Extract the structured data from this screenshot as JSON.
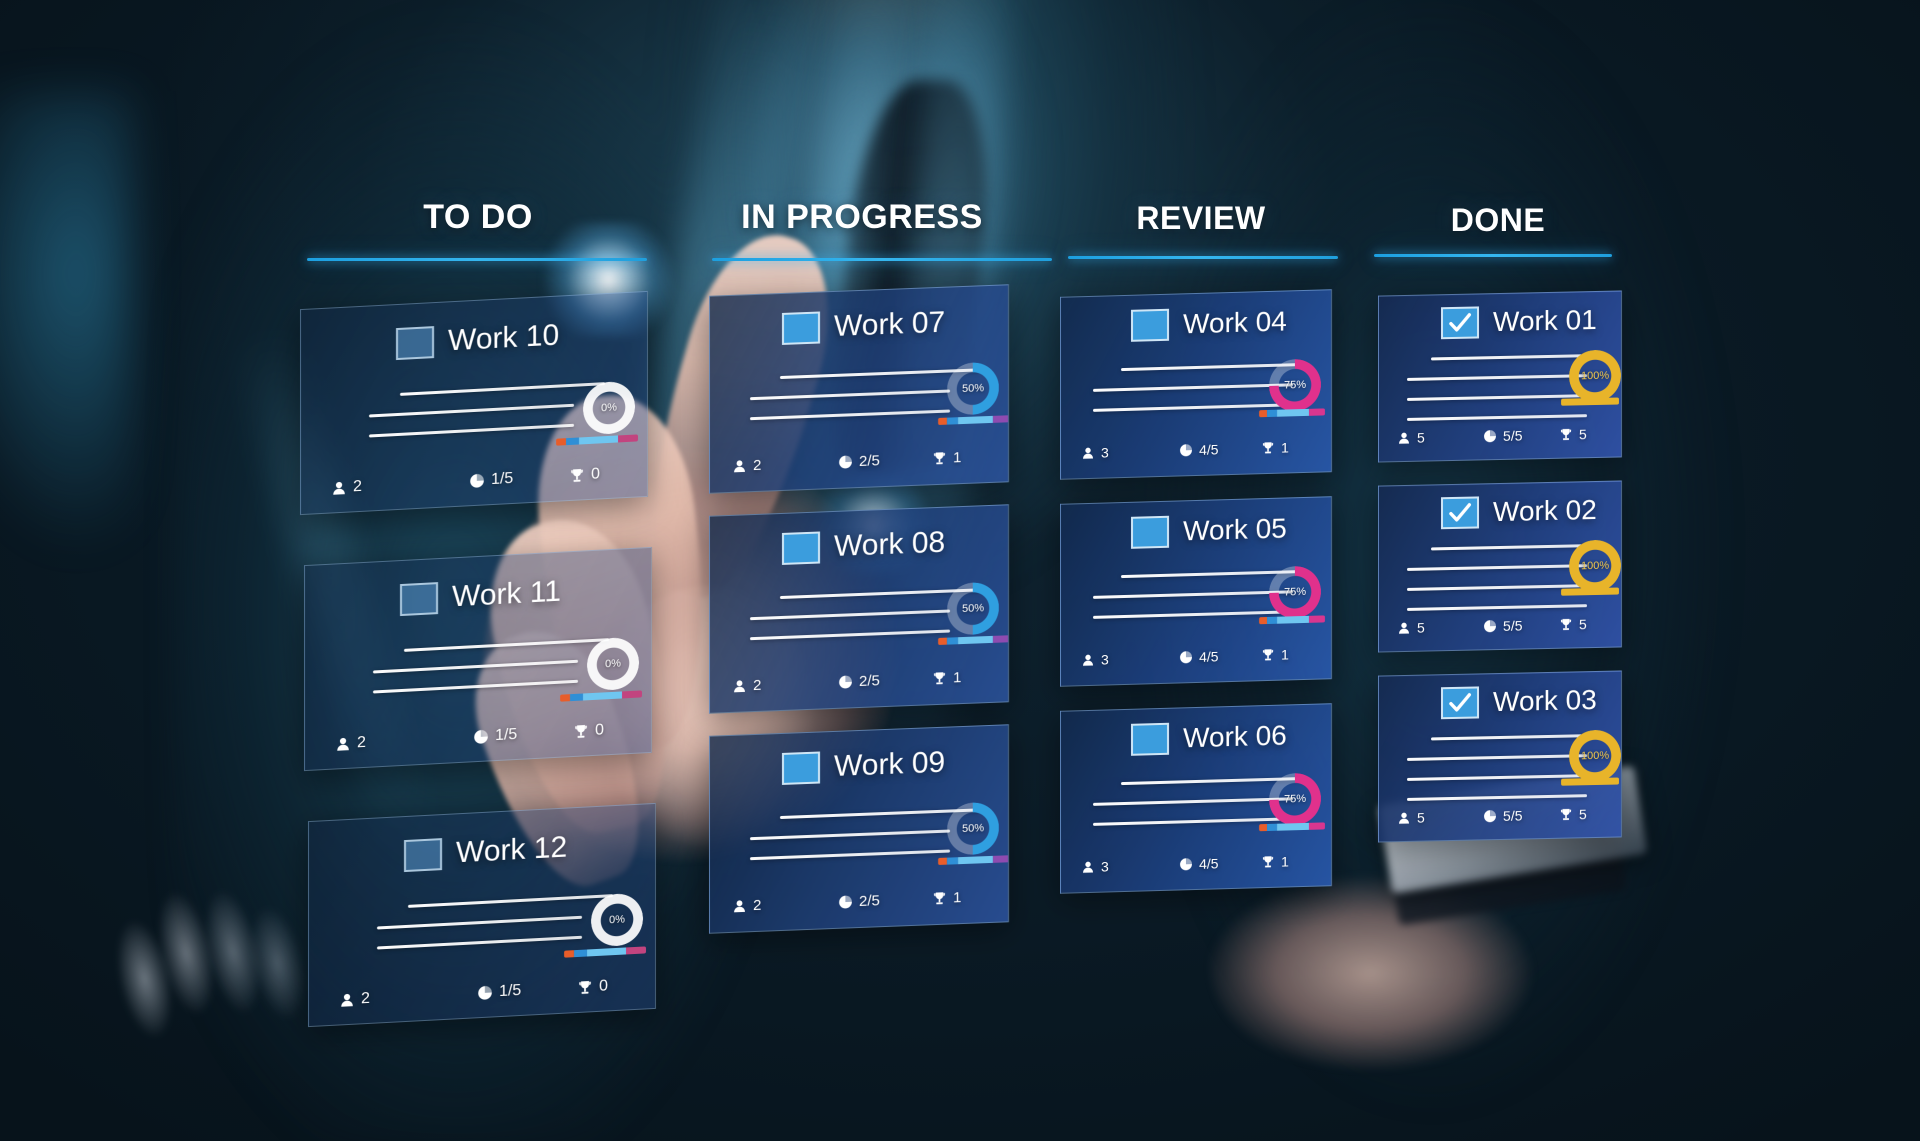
{
  "board": {
    "columns": [
      {
        "id": "todo",
        "title": "TO DO",
        "accent": "#2ba4e3",
        "cards": [
          {
            "title": "Work 10",
            "checked": false,
            "progress_label": "0%",
            "progress_value": 0,
            "ring_color": "#ffffff",
            "lines": 3,
            "members_icon": "person-icon",
            "members": "2",
            "tasks_icon": "pie-clock-icon",
            "tasks": "1/5",
            "awards_icon": "trophy-icon",
            "awards": "0",
            "segments": [
              "#e85d2a",
              "#2f8fd6",
              "#6fc6f0",
              "#c2447f"
            ]
          },
          {
            "title": "Work 11",
            "checked": false,
            "progress_label": "0%",
            "progress_value": 0,
            "ring_color": "#ffffff",
            "lines": 3,
            "members_icon": "person-icon",
            "members": "2",
            "tasks_icon": "pie-clock-icon",
            "tasks": "1/5",
            "awards_icon": "trophy-icon",
            "awards": "0",
            "segments": [
              "#e85d2a",
              "#2f8fd6",
              "#6fc6f0",
              "#c2447f"
            ]
          },
          {
            "title": "Work 12",
            "checked": false,
            "progress_label": "0%",
            "progress_value": 0,
            "ring_color": "#ffffff",
            "lines": 3,
            "members_icon": "person-icon",
            "members": "2",
            "tasks_icon": "pie-clock-icon",
            "tasks": "1/5",
            "awards_icon": "trophy-icon",
            "awards": "0",
            "segments": [
              "#e85d2a",
              "#2f8fd6",
              "#6fc6f0",
              "#c2447f"
            ]
          }
        ]
      },
      {
        "id": "inprogress",
        "title": "IN PROGRESS",
        "accent": "#2ba4e3",
        "cards": [
          {
            "title": "Work 07",
            "checked": false,
            "progress_label": "50%",
            "progress_value": 50,
            "ring_color": "#2f9fe0",
            "lines": 3,
            "members_icon": "person-icon",
            "members": "2",
            "tasks_icon": "pie-clock-icon",
            "tasks": "2/5",
            "awards_icon": "trophy-icon",
            "awards": "1",
            "segments": [
              "#e85d2a",
              "#2f8fd6",
              "#6fc6f0",
              "#8e4bb0"
            ]
          },
          {
            "title": "Work 08",
            "checked": false,
            "progress_label": "50%",
            "progress_value": 50,
            "ring_color": "#2f9fe0",
            "lines": 3,
            "members_icon": "person-icon",
            "members": "2",
            "tasks_icon": "pie-clock-icon",
            "tasks": "2/5",
            "awards_icon": "trophy-icon",
            "awards": "1",
            "segments": [
              "#e85d2a",
              "#2f8fd6",
              "#6fc6f0",
              "#8e4bb0"
            ]
          },
          {
            "title": "Work 09",
            "checked": false,
            "progress_label": "50%",
            "progress_value": 50,
            "ring_color": "#2f9fe0",
            "lines": 3,
            "members_icon": "person-icon",
            "members": "2",
            "tasks_icon": "pie-clock-icon",
            "tasks": "2/5",
            "awards_icon": "trophy-icon",
            "awards": "1",
            "segments": [
              "#e85d2a",
              "#2f8fd6",
              "#6fc6f0",
              "#8e4bb0"
            ]
          }
        ]
      },
      {
        "id": "review",
        "title": "REVIEW",
        "accent": "#2ba4e3",
        "cards": [
          {
            "title": "Work 04",
            "checked": false,
            "progress_label": "75%",
            "progress_value": 75,
            "ring_color": "#e0318c",
            "lines": 3,
            "members_icon": "person-icon",
            "members": "3",
            "tasks_icon": "pie-clock-icon",
            "tasks": "4/5",
            "awards_icon": "trophy-icon",
            "awards": "1",
            "segments": [
              "#e85d2a",
              "#2f8fd6",
              "#6fc6f0",
              "#d8368f"
            ]
          },
          {
            "title": "Work 05",
            "checked": false,
            "progress_label": "75%",
            "progress_value": 75,
            "ring_color": "#e0318c",
            "lines": 3,
            "members_icon": "person-icon",
            "members": "3",
            "tasks_icon": "pie-clock-icon",
            "tasks": "4/5",
            "awards_icon": "trophy-icon",
            "awards": "1",
            "segments": [
              "#e85d2a",
              "#2f8fd6",
              "#6fc6f0",
              "#d8368f"
            ]
          },
          {
            "title": "Work 06",
            "checked": false,
            "progress_label": "75%",
            "progress_value": 75,
            "ring_color": "#e0318c",
            "lines": 3,
            "members_icon": "person-icon",
            "members": "3",
            "tasks_icon": "pie-clock-icon",
            "tasks": "4/5",
            "awards_icon": "trophy-icon",
            "awards": "1",
            "segments": [
              "#e85d2a",
              "#2f8fd6",
              "#6fc6f0",
              "#d8368f"
            ]
          }
        ]
      },
      {
        "id": "done",
        "title": "DONE",
        "accent": "#2ba4e3",
        "cards": [
          {
            "title": "Work 01",
            "checked": true,
            "progress_label": "100%",
            "progress_value": 100,
            "ring_color": "#e8b42a",
            "lines": 4,
            "members_icon": "person-icon",
            "members": "5",
            "tasks_icon": "pie-clock-icon",
            "tasks": "5/5",
            "awards_icon": "trophy-icon",
            "awards": "5",
            "segments": [
              "#e8b42a"
            ]
          },
          {
            "title": "Work 02",
            "checked": true,
            "progress_label": "100%",
            "progress_value": 100,
            "ring_color": "#e8b42a",
            "lines": 4,
            "members_icon": "person-icon",
            "members": "5",
            "tasks_icon": "pie-clock-icon",
            "tasks": "5/5",
            "awards_icon": "trophy-icon",
            "awards": "5",
            "segments": [
              "#e8b42a"
            ]
          },
          {
            "title": "Work 03",
            "checked": true,
            "progress_label": "100%",
            "progress_value": 100,
            "ring_color": "#e8b42a",
            "lines": 4,
            "members_icon": "person-icon",
            "members": "5",
            "tasks_icon": "pie-clock-icon",
            "tasks": "5/5",
            "awards_icon": "trophy-icon",
            "awards": "5",
            "segments": [
              "#e8b42a"
            ]
          }
        ]
      }
    ]
  }
}
